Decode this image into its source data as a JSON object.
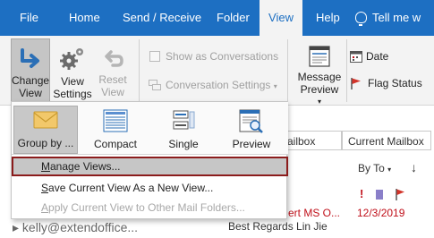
{
  "tabs": [
    {
      "label": "File"
    },
    {
      "label": "Home"
    },
    {
      "label": "Send / Receive"
    },
    {
      "label": "Folder"
    },
    {
      "label": "View"
    },
    {
      "label": "Help"
    },
    {
      "label": "Tell me w"
    }
  ],
  "ribbon": {
    "change_view": {
      "line1": "Change",
      "line2": "View"
    },
    "view_settings": {
      "line1": "View",
      "line2": "Settings"
    },
    "reset_view": {
      "line1": "Reset",
      "line2": "View"
    },
    "show_as_conversations": "Show as Conversations",
    "conversation_settings": "Conversation Settings",
    "message_preview": {
      "line1": "Message",
      "line2": "Preview"
    },
    "arrange_date": "Date",
    "arrange_flag_status": "Flag Status"
  },
  "dropdown": {
    "gallery": [
      {
        "label": "Group by ..."
      },
      {
        "label": "Compact"
      },
      {
        "label": "Single"
      },
      {
        "label": "Preview"
      }
    ],
    "menu": [
      {
        "pre": "",
        "key": "M",
        "post": "anage Views..."
      },
      {
        "pre": "",
        "key": "S",
        "post": "ave Current View As a New View..."
      },
      {
        "pre": "",
        "key": "A",
        "post": "pply Current View to Other Mail Folders..."
      }
    ]
  },
  "mail": {
    "folder_header_partial": "ailbox",
    "current_mailbox": "Current Mailbox",
    "sort_label": "By To",
    "sender_partial": "ert MS O...",
    "date": "12/3/2019",
    "preview_text": "Best Regards  Lin Jie",
    "account_partial": "kelly@extendoffice..."
  },
  "colors": {
    "tabbar": "#1d6fc2",
    "highlight_outline": "#8b1c1c",
    "unread_red": "#c0101a",
    "category_purple": "#8a7fc9"
  }
}
